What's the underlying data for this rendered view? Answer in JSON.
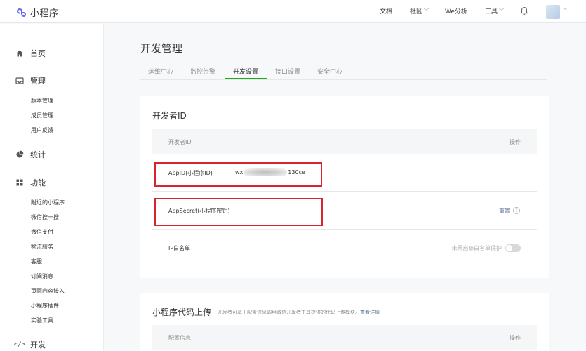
{
  "app": {
    "title": "小程序"
  },
  "topnav": {
    "docs": "文档",
    "community": "社区",
    "we_analytics": "We分析",
    "tools": "工具"
  },
  "sidebar": {
    "home": "首页",
    "manage": "管理",
    "manage_items": [
      "版本管理",
      "成员管理",
      "用户反馈"
    ],
    "stats": "统计",
    "features": "功能",
    "feature_items": [
      "附近的小程序",
      "微信搜一搜",
      "微信支付",
      "物流服务",
      "客服",
      "订阅消息",
      "页面内容接入",
      "小程序插件",
      "实验工具"
    ],
    "develop": "开发"
  },
  "page": {
    "title": "开发管理",
    "tabs": [
      "运维中心",
      "监控告警",
      "开发设置",
      "接口设置",
      "安全中心"
    ],
    "active_tab": "开发设置"
  },
  "developer_id": {
    "title": "开发者ID",
    "col_name": "开发者ID",
    "col_action": "操作",
    "appid_label": "AppID(小程序ID)",
    "appid_prefix": "wx",
    "appid_suffix": "130ce",
    "secret_label": "AppSecret(小程序密钥)",
    "reset": "重置",
    "ip_label": "IP白名单",
    "ip_status": "未开启Ip白名单保护"
  },
  "code_upload": {
    "title": "小程序代码上传",
    "desc": "开发者可基于配置信息调用微信开发者工具提供的代码上传模块。",
    "link": "查看详情",
    "col_name": "配置信息",
    "col_action": "操作"
  },
  "colors": {
    "accent": "#1aad19",
    "link": "#576b95",
    "highlight": "#d9232d"
  }
}
